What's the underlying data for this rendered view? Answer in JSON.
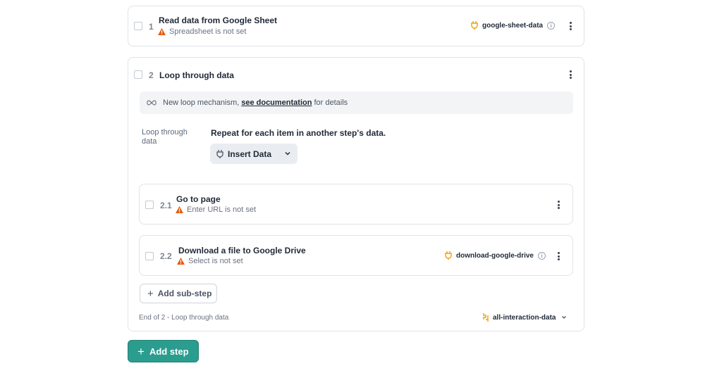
{
  "steps": [
    {
      "number": "1",
      "title": "Read data from Google Sheet",
      "warning": "Spreadsheet is not set",
      "connection": "google-sheet-data"
    },
    {
      "number": "2",
      "title": "Loop through data",
      "notice": {
        "prefix": "New loop mechanism,",
        "link": "see documentation",
        "suffix": "for details"
      },
      "field_label": "Loop through data",
      "field_description": "Repeat for each item in another step's data.",
      "insert_button": "Insert Data",
      "substeps": [
        {
          "number": "2.1",
          "title": "Go to page",
          "warning": "Enter URL is not set"
        },
        {
          "number": "2.2",
          "title": "Download a file to Google Drive",
          "warning": "Select is not set",
          "connection": "download-google-drive"
        }
      ],
      "add_substep_label": "Add sub-step",
      "end_label": "End of 2 - Loop through data",
      "end_connection": "all-interaction-data"
    }
  ],
  "add_step_label": "Add step",
  "colors": {
    "accent": "#2a9d8f",
    "warning": "#e8590c",
    "connection": "#f59f00"
  }
}
